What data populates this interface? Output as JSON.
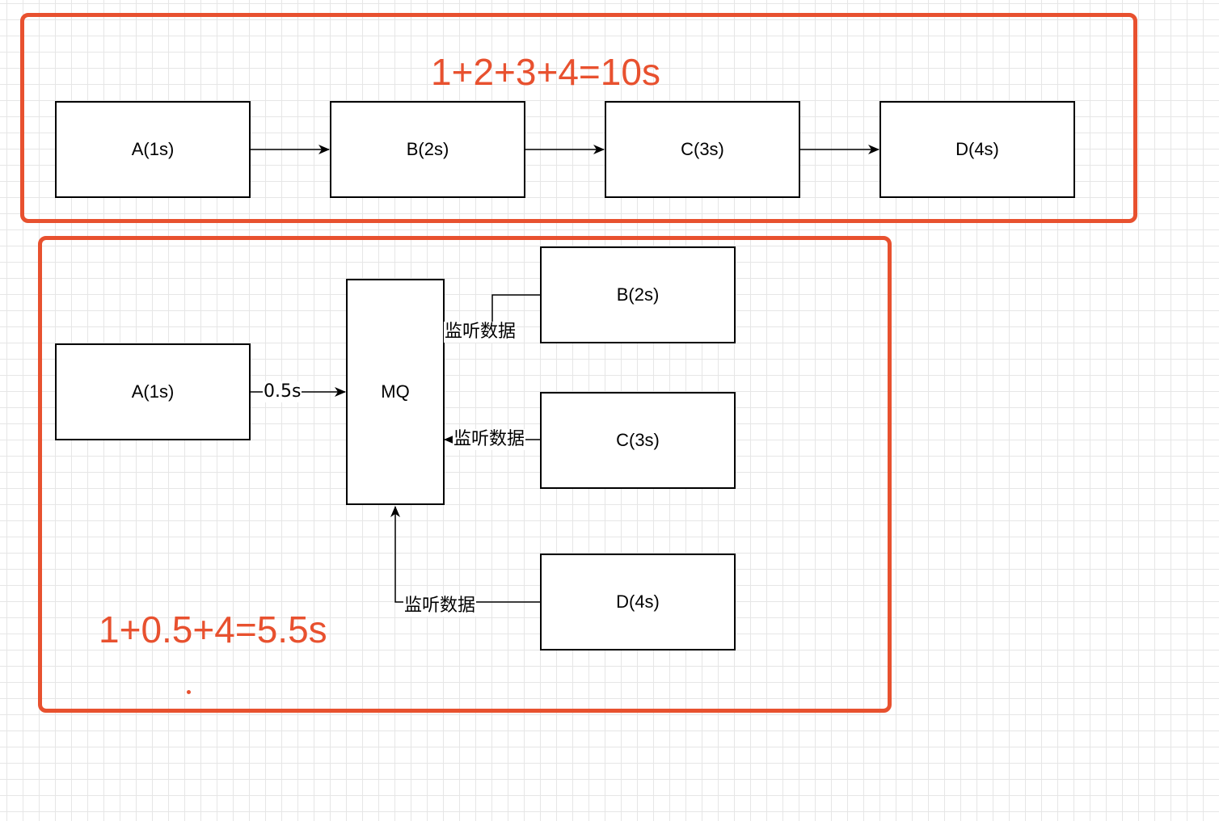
{
  "colors": {
    "frame": "#e8512f",
    "line": "#000000",
    "grid": "#e6e6e6"
  },
  "sync": {
    "total": "1+2+3+4=10s",
    "nodes": {
      "a": "A(1s)",
      "b": "B(2s)",
      "c": "C(3s)",
      "d": "D(4s)"
    }
  },
  "async": {
    "total": "1+0.5+4=5.5s",
    "nodes": {
      "a": "A(1s)",
      "mq": "MQ",
      "b": "B(2s)",
      "c": "C(3s)",
      "d": "D(4s)"
    },
    "edges": {
      "a_to_mq": "0.5s",
      "b_listen": "监听数据",
      "c_listen": "监听数据",
      "d_listen": "监听数据"
    }
  }
}
